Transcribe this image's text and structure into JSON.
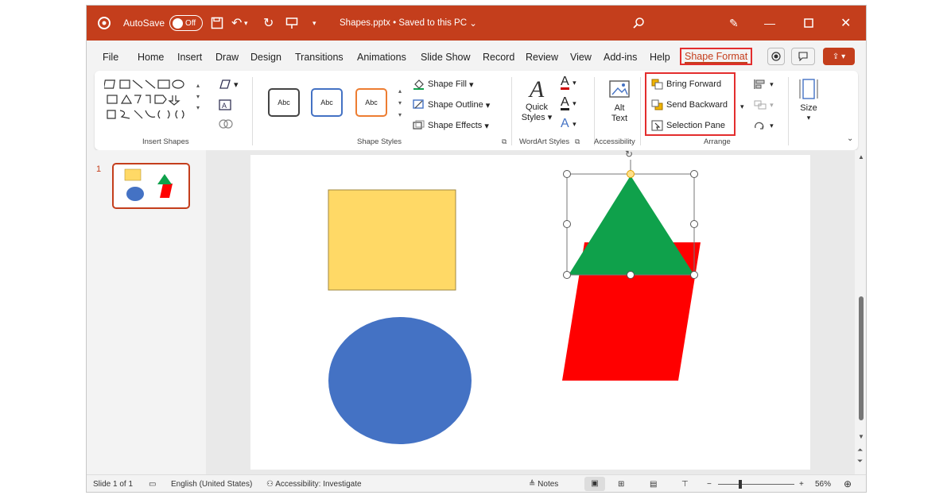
{
  "titlebar": {
    "autosave_label": "AutoSave",
    "toggle_state": "Off",
    "file_title": "Shapes.pptx • Saved to this PC"
  },
  "tabs": [
    "File",
    "Home",
    "Insert",
    "Draw",
    "Design",
    "Transitions",
    "Animations",
    "Slide Show",
    "Record",
    "Review",
    "View",
    "Add-ins",
    "Help",
    "Shape Format"
  ],
  "ribbon": {
    "groups": {
      "insert_shapes": "Insert Shapes",
      "shape_styles": "Shape Styles",
      "wordart": "WordArt Styles",
      "accessibility": "Accessibility",
      "arrange": "Arrange"
    },
    "style_sample": "Abc",
    "shape_fill": "Shape Fill",
    "shape_outline": "Shape Outline",
    "shape_effects": "Shape Effects",
    "quick_styles": "Quick",
    "quick_styles2": "Styles",
    "alt_text": "Alt",
    "alt_text2": "Text",
    "bring_forward": "Bring Forward",
    "send_backward": "Send Backward",
    "selection_pane": "Selection Pane",
    "size": "Size"
  },
  "thumbnail": {
    "number": "1"
  },
  "status": {
    "slide": "Slide 1 of 1",
    "language": "English (United States)",
    "accessibility": "Accessibility: Investigate",
    "notes": "Notes",
    "zoom": "56%"
  },
  "colors": {
    "accent": "#c43e1c",
    "highlight": "#e32d2d",
    "yellow": "#ffd966",
    "blue": "#4472c4",
    "green": "#0fa14b",
    "red": "#ff0000"
  }
}
